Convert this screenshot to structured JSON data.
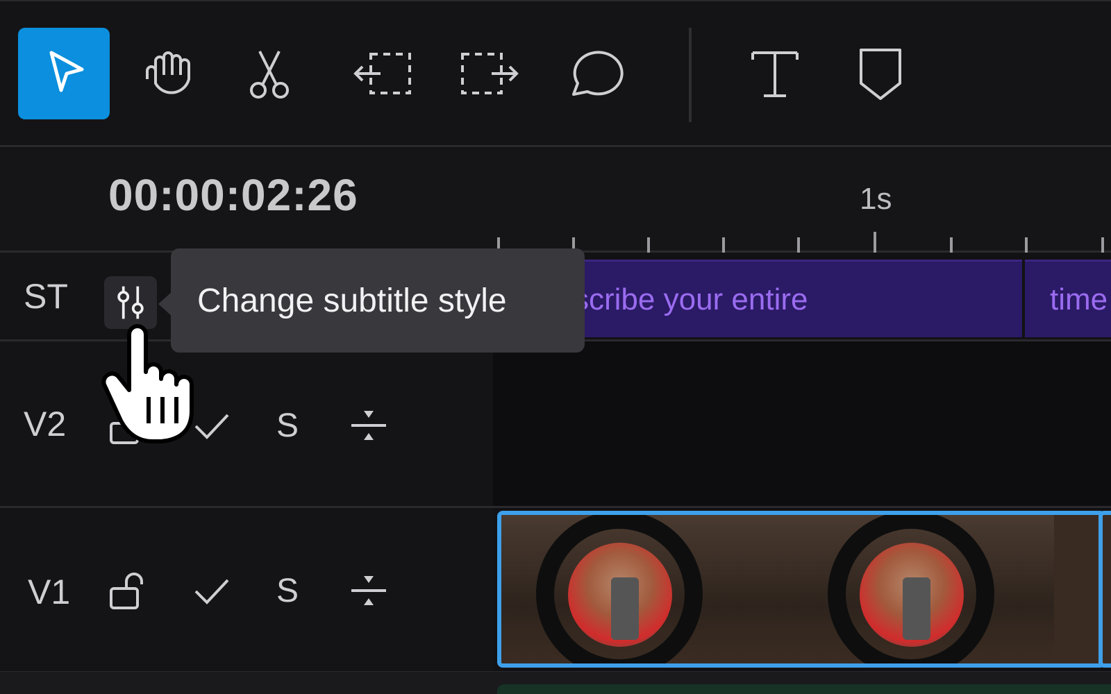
{
  "toolbar": {
    "tools": [
      {
        "name": "select",
        "icon": "arrow-pointer-icon",
        "active": true
      },
      {
        "name": "hand",
        "icon": "hand-icon"
      },
      {
        "name": "cut",
        "icon": "scissors-icon"
      },
      {
        "name": "trim-left",
        "icon": "trim-left-icon"
      },
      {
        "name": "trim-right",
        "icon": "trim-right-icon"
      },
      {
        "name": "comment",
        "icon": "speech-bubble-icon"
      },
      {
        "name": "text",
        "icon": "text-icon"
      },
      {
        "name": "marker",
        "icon": "marker-icon"
      }
    ],
    "accent": "#0b8fde"
  },
  "timeline": {
    "timecode": "00:00:02:26",
    "ruler_label": "1s"
  },
  "tracks": {
    "st": {
      "label": "ST",
      "clips": [
        "scribe your entire",
        "time"
      ]
    },
    "v2": {
      "label": "V2",
      "solo": "S"
    },
    "v1": {
      "label": "V1",
      "solo": "S"
    }
  },
  "tooltip": {
    "text": "Change subtitle style"
  },
  "colors": {
    "subtitle_clip_bg": "#2b1a66",
    "subtitle_text": "#9a6cf0",
    "video_clip_border": "#3ea0ea"
  }
}
